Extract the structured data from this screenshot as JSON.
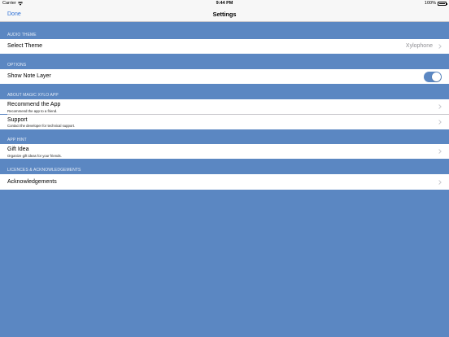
{
  "status_bar": {
    "carrier": "Carrier",
    "time": "9:44 PM",
    "battery": "100%"
  },
  "nav": {
    "done_label": "Done",
    "title": "Settings"
  },
  "sections": {
    "audio_theme": {
      "header": "AUDIO THEME",
      "select_theme_label": "Select Theme",
      "select_theme_value": "Xylophone"
    },
    "options": {
      "header": "OPTIONS",
      "show_note_layer_label": "Show Note Layer",
      "show_note_layer_on": true
    },
    "about": {
      "header": "ABOUT MAGIC XYLO APP",
      "recommend_title": "Recommend the App",
      "recommend_subtitle": "Recommend the app to a friend.",
      "support_title": "Support",
      "support_subtitle": "Contact the developer for technical support."
    },
    "app_hint": {
      "header": "APP HINT",
      "gift_title": "Gift Idea",
      "gift_subtitle": "Organize gift ideas for your friends."
    },
    "licences": {
      "header": "LICENCES & ACKNOWLEDGEMENTS",
      "acknowledgements_label": "Acknowledgements"
    }
  },
  "colors": {
    "background": "#5b87c2",
    "accent": "#2b6fd6",
    "row_background": "#ffffff",
    "header_text": "#e7eef8"
  },
  "icons": {
    "wifi": "wifi-icon",
    "battery": "battery-icon",
    "chevron": "chevron-right-icon"
  }
}
